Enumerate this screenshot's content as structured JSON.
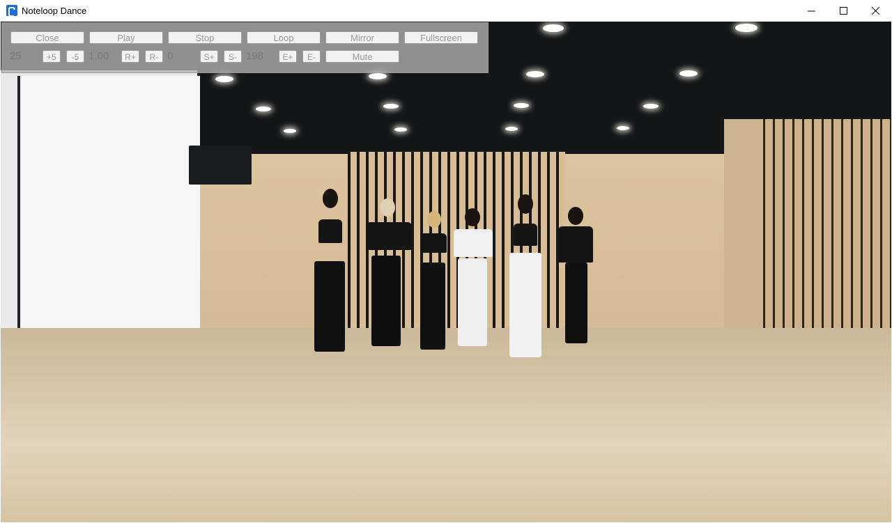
{
  "window": {
    "title": "Noteloop Dance",
    "icon": "noteloop-app-icon"
  },
  "controls": {
    "row1": [
      "Close",
      "Play",
      "Stop",
      "Loop",
      "Mirror",
      "Fullscreen"
    ],
    "volume": {
      "value": "25",
      "up": "+5",
      "down": "-5"
    },
    "rate": {
      "value": "1.00",
      "up": "R+",
      "down": "R-"
    },
    "start": {
      "value": "0",
      "up": "S+",
      "down": "S-"
    },
    "end": {
      "value": "198",
      "up": "E+",
      "down": "E-"
    },
    "mute": "Mute"
  },
  "video": {
    "scene": "dance practice room video frame"
  },
  "icons": [
    "minimize-icon",
    "maximize-icon",
    "close-icon"
  ]
}
